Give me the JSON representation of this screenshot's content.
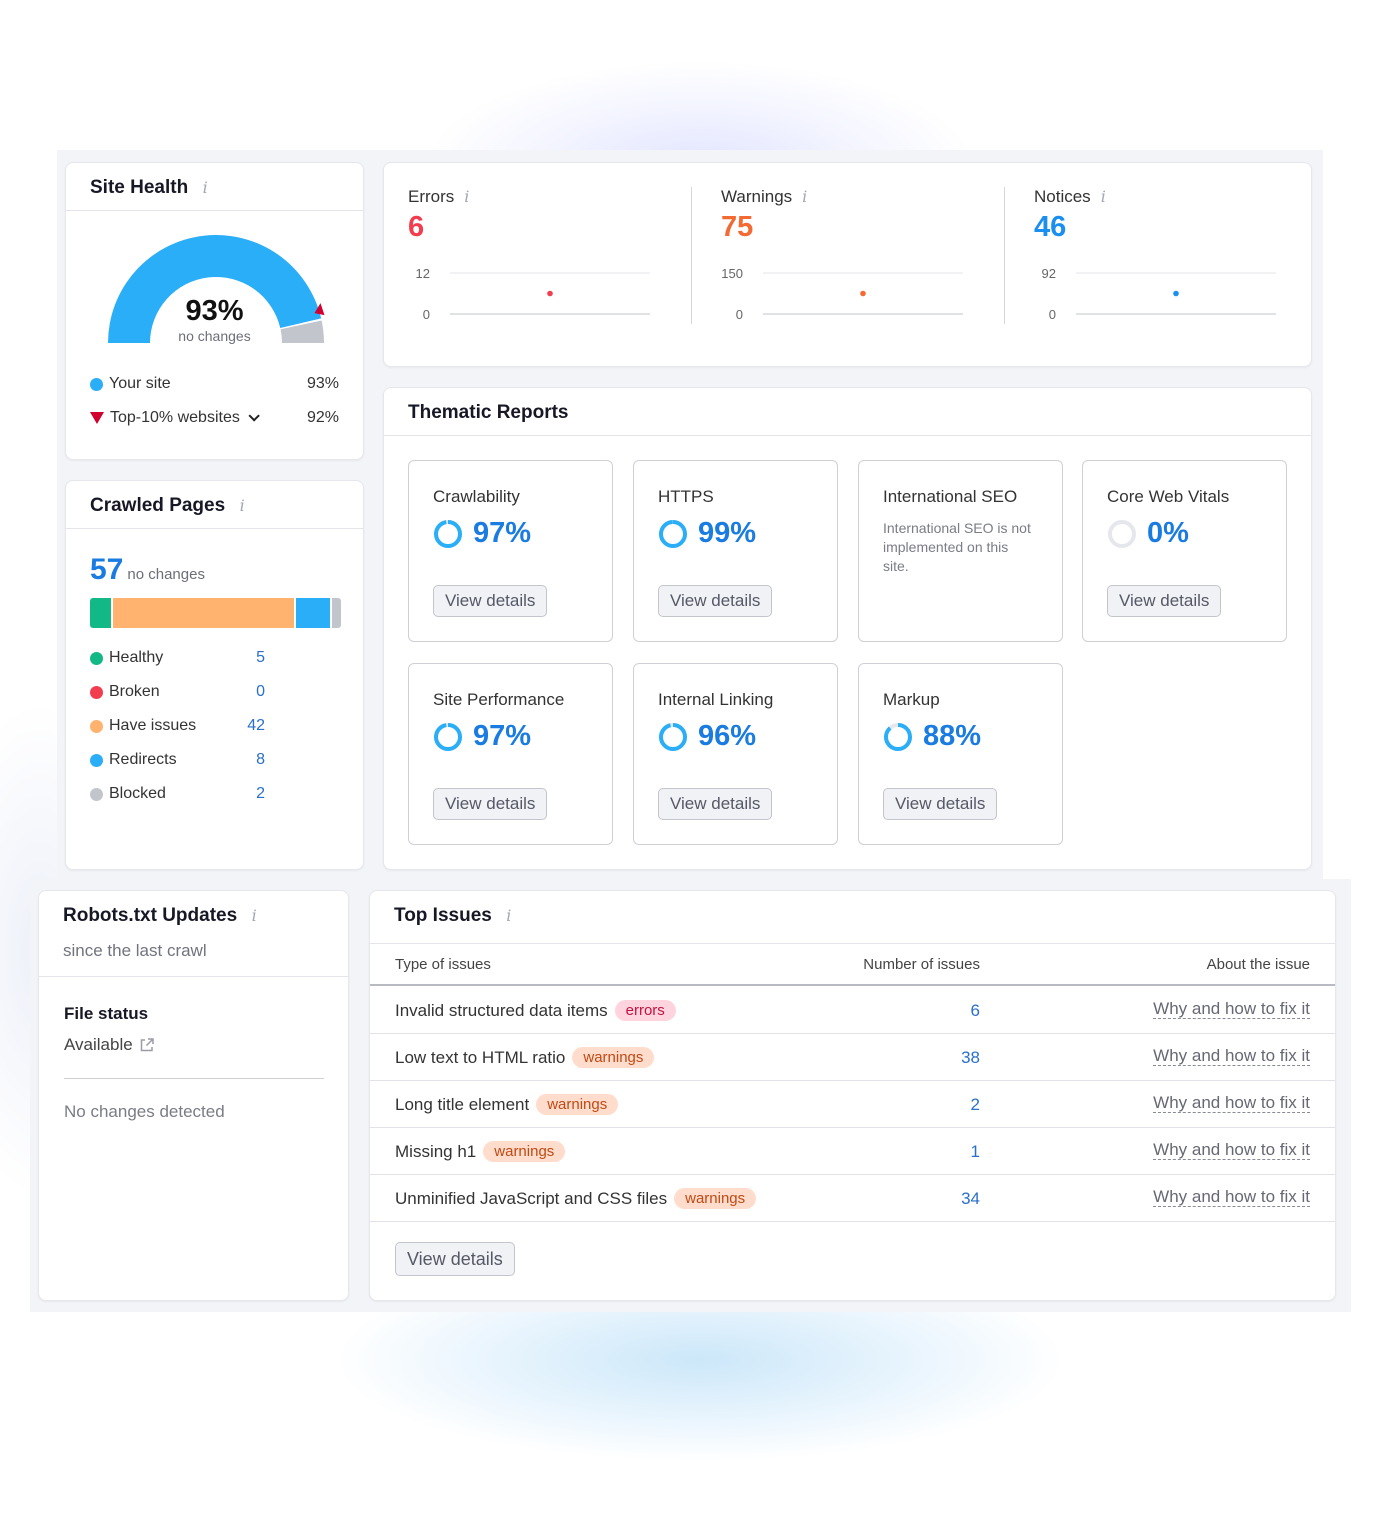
{
  "colors": {
    "blue": "#2aaef7",
    "blue_text": "#1a7be0",
    "error_red": "#f23d4f",
    "warning_orange": "#f46a33",
    "notice_blue": "#1a8ff0",
    "gray": "#c3c5cd",
    "green": "#12b886",
    "peach": "#ffb36e",
    "triangle_red": "#d1002f"
  },
  "site_health": {
    "title": "Site Health",
    "info_icon": "info-icon",
    "score": "93%",
    "score_fraction": 0.93,
    "status": "no changes",
    "top10_marker_fraction": 0.92,
    "legend": [
      {
        "label": "Your site",
        "value": "93%",
        "marker": "dot"
      },
      {
        "label": "Top-10% websites",
        "value": "92%",
        "marker": "triangle"
      }
    ]
  },
  "crawled_pages": {
    "title": "Crawled Pages",
    "total": "57",
    "status": "no changes",
    "categories": [
      {
        "label": "Healthy",
        "value": 5,
        "color": "#12b886"
      },
      {
        "label": "Broken",
        "value": 0,
        "color": "#f23d4f"
      },
      {
        "label": "Have issues",
        "value": 42,
        "color": "#ffb36e"
      },
      {
        "label": "Redirects",
        "value": 8,
        "color": "#2aaef7"
      },
      {
        "label": "Blocked",
        "value": 2,
        "color": "#c3c5cd"
      }
    ]
  },
  "issues_summary": [
    {
      "label": "Errors",
      "value": "6",
      "color": "#f23d4f",
      "axis_max": "12",
      "axis_min": "0",
      "point": 6,
      "max": 12
    },
    {
      "label": "Warnings",
      "value": "75",
      "color": "#f46a33",
      "axis_max": "150",
      "axis_min": "0",
      "point": 75,
      "max": 150
    },
    {
      "label": "Notices",
      "value": "46",
      "color": "#1a8ff0",
      "axis_max": "92",
      "axis_min": "0",
      "point": 46,
      "max": 92
    }
  ],
  "thematic": {
    "title": "Thematic Reports",
    "button_label": "View details",
    "reports": [
      {
        "name": "Crawlability",
        "score": "97%",
        "fraction": 0.97
      },
      {
        "name": "HTTPS",
        "score": "99%",
        "fraction": 0.99
      },
      {
        "name": "International SEO",
        "note": "International SEO is not implemented on this site."
      },
      {
        "name": "Core Web Vitals",
        "score": "0%",
        "fraction": 0
      },
      {
        "name": "Site Performance",
        "score": "97%",
        "fraction": 0.97
      },
      {
        "name": "Internal Linking",
        "score": "96%",
        "fraction": 0.96
      },
      {
        "name": "Markup",
        "score": "88%",
        "fraction": 0.88
      }
    ]
  },
  "robots": {
    "title": "Robots.txt Updates",
    "subtitle": "since the last crawl",
    "file_status_label": "File status",
    "file_status_value": "Available",
    "external_icon": "external-link-icon",
    "changes": "No changes detected"
  },
  "top_issues": {
    "title": "Top Issues",
    "columns": [
      "Type of issues",
      "Number of issues",
      "About the issue"
    ],
    "rows": [
      {
        "issue": "Invalid structured data items",
        "type": "errors",
        "count": "6",
        "link": "Why and how to fix it"
      },
      {
        "issue": "Low text to HTML ratio",
        "type": "warnings",
        "count": "38",
        "link": "Why and how to fix it"
      },
      {
        "issue": "Long title element",
        "type": "warnings",
        "count": "2",
        "link": "Why and how to fix it"
      },
      {
        "issue": "Missing h1",
        "type": "warnings",
        "count": "1",
        "link": "Why and how to fix it"
      },
      {
        "issue": "Unminified JavaScript and CSS files",
        "type": "warnings",
        "count": "34",
        "link": "Why and how to fix it"
      }
    ],
    "button_label": "View details"
  }
}
